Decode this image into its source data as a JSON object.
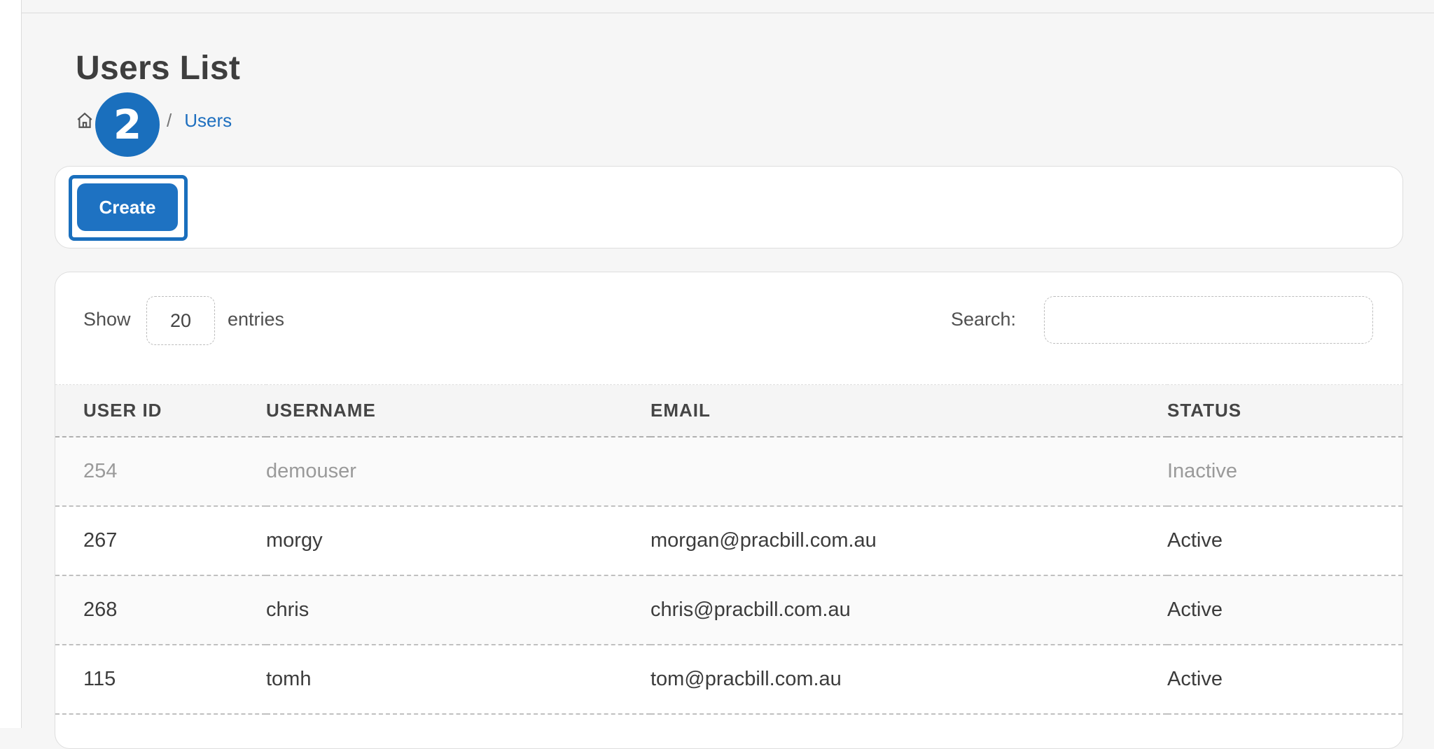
{
  "page": {
    "title": "Users List"
  },
  "breadcrumb": {
    "home_icon": "home-icon",
    "separator": "/",
    "current": "Users"
  },
  "step_badge": "2",
  "toolbar": {
    "create_label": "Create"
  },
  "table_controls": {
    "show_label": "Show",
    "entries_value": "20",
    "entries_label": "entries",
    "search_label": "Search:",
    "search_value": ""
  },
  "table": {
    "columns": [
      "USER ID",
      "USERNAME",
      "EMAIL",
      "STATUS"
    ],
    "rows": [
      {
        "user_id": "254",
        "username": "demouser",
        "email": "",
        "status": "Inactive"
      },
      {
        "user_id": "267",
        "username": "morgy",
        "email": "morgan@pracbill.com.au",
        "status": "Active"
      },
      {
        "user_id": "268",
        "username": "chris",
        "email": "chris@pracbill.com.au",
        "status": "Active"
      },
      {
        "user_id": "115",
        "username": "tomh",
        "email": "tom@pracbill.com.au",
        "status": "Active"
      }
    ]
  },
  "colors": {
    "accent": "#1e72c2",
    "link": "#1e6fbf",
    "inactive_text": "#9a9a9a"
  }
}
